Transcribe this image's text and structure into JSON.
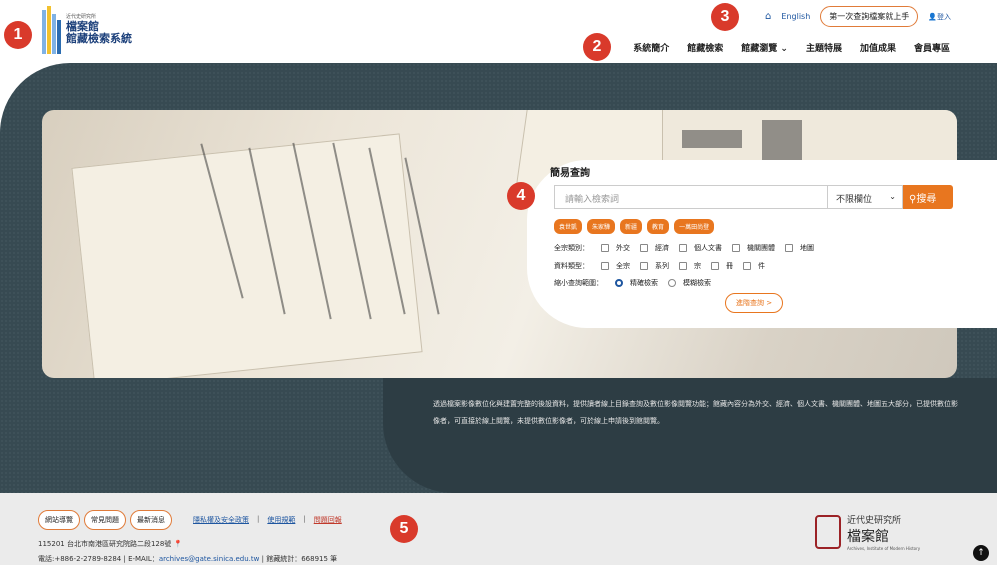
{
  "logo": {
    "small": "近代史研究所",
    "line1": "檔案館",
    "line2": "館藏檢索系統"
  },
  "util": {
    "english": "English",
    "first_time": "第一次查詢檔案就上手",
    "login": "登入"
  },
  "nav": {
    "items": [
      "系統簡介",
      "館藏檢索",
      "館藏瀏覽",
      "主題特展",
      "加值成果",
      "會員專區"
    ]
  },
  "search": {
    "title": "簡易查詢",
    "placeholder": "請輸入檢索詞",
    "field_select": "不限欄位",
    "button": "搜尋",
    "tags": [
      "袁世凱",
      "朱家驊",
      "新疆",
      "教育",
      "一萬田尚登"
    ],
    "category_label": "全宗類別：",
    "categories": [
      "外交",
      "經濟",
      "個人文書",
      "機關團體",
      "地圖"
    ],
    "type_label": "資料類型：",
    "types": [
      "全宗",
      "系列",
      "宗",
      "冊",
      "件"
    ],
    "scope_label": "縮小查詢範圍：",
    "scopes": [
      "精確檢索",
      "模糊檢索"
    ],
    "advanced": "進階查詢 >"
  },
  "description": "透過檔案影像數位化與建置完整的後設資料，提供讀者線上目錄查詢及數位影像閱覽功能；館藏內容分為外交、經濟、個人文書、機關團體、地圖五大部分，已提供數位影像者，可直接於線上閱覽，未提供數位影像者，可於線上申請後到館閱覽。",
  "footer": {
    "buttons": [
      "網站導覽",
      "常見問題",
      "最新消息"
    ],
    "links": [
      "隱私權及安全政策",
      "使用規範",
      "問題回報"
    ],
    "address": "115201 台北市南港區研究院路二段128號",
    "phone": "電話:+886-2-2789-8284",
    "email_label": "E-MAIL：",
    "email": "archives@gate.sinica.edu.tw",
    "stats": "館藏統計：668915 筆",
    "mark_line1": "近代史研究所",
    "mark_line2": "檔案館",
    "mark_line3": "Archives, Institute of Modern History"
  },
  "callouts": [
    "1",
    "2",
    "3",
    "4",
    "5"
  ],
  "colors": {
    "accent": "#e8761f",
    "dark_bg": "#374a52",
    "link": "#1e56a0",
    "callout": "#d93a2b"
  }
}
